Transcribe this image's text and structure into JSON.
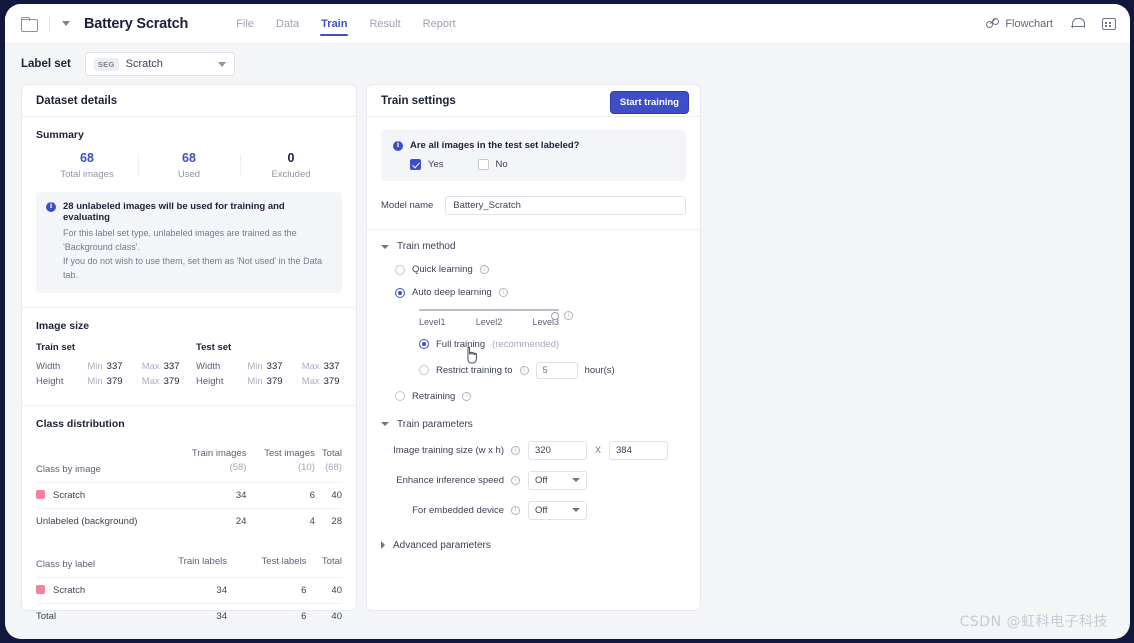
{
  "topbar": {
    "folder_icon": "folder-icon",
    "chevron_icon": "chevron-down-icon",
    "app_title": "Battery Scratch",
    "nav": [
      {
        "label": "File",
        "active": false
      },
      {
        "label": "Data",
        "active": false
      },
      {
        "label": "Train",
        "active": true
      },
      {
        "label": "Result",
        "active": false
      },
      {
        "label": "Report",
        "active": false
      }
    ],
    "flowchart_label": "Flowchart",
    "bell_icon": "bell-icon",
    "grid_icon": "grid-icon"
  },
  "labelset": {
    "label": "Label set",
    "badge": "SEG",
    "value": "Scratch"
  },
  "left_panel": {
    "title": "Dataset details",
    "summary": {
      "title": "Summary",
      "stats": [
        {
          "value": "68",
          "label": "Total images"
        },
        {
          "value": "68",
          "label": "Used"
        },
        {
          "value": "0",
          "label": "Excluded"
        }
      ],
      "callout": {
        "title": "28 unlabeled images will be used for training and evaluating",
        "line1": "For this label set type, unlabeled images are trained as the 'Background class'.",
        "line2": "If you do not wish to use them, set them as 'Not used' in the Data tab."
      }
    },
    "image_size": {
      "title": "Image size",
      "sets": [
        {
          "name": "Train set",
          "rows": [
            {
              "dim": "Width",
              "min_label": "Min",
              "min": "337",
              "max_label": "Max",
              "max": "337"
            },
            {
              "dim": "Height",
              "min_label": "Min",
              "min": "379",
              "max_label": "Max",
              "max": "379"
            }
          ]
        },
        {
          "name": "Test set",
          "rows": [
            {
              "dim": "Width",
              "min_label": "Min",
              "min": "337",
              "max_label": "Max",
              "max": "337"
            },
            {
              "dim": "Height",
              "min_label": "Min",
              "min": "379",
              "max_label": "Max",
              "max": "379"
            }
          ]
        }
      ]
    },
    "class_distribution": {
      "title": "Class distribution",
      "by_image": {
        "header": "Class by image",
        "col_train": "Train images",
        "col_train_sub": "(58)",
        "col_test": "Test images",
        "col_test_sub": "(10)",
        "col_total": "Total",
        "col_total_sub": "(68)",
        "rows": [
          {
            "name": "Scratch",
            "color": "#f77fa0",
            "swatch": true,
            "train": "34",
            "test": "6",
            "total": "40"
          },
          {
            "name": "Unlabeled (background)",
            "swatch": false,
            "train": "24",
            "test": "4",
            "total": "28"
          }
        ]
      },
      "by_label": {
        "header": "Class by label",
        "col_train": "Train labels",
        "col_test": "Test labels",
        "col_total": "Total",
        "rows": [
          {
            "name": "Scratch",
            "color": "#f77fa0",
            "swatch": true,
            "train": "34",
            "test": "6",
            "total": "40"
          },
          {
            "name": "Total",
            "swatch": false,
            "train": "34",
            "test": "6",
            "total": "40"
          }
        ]
      }
    }
  },
  "right_panel": {
    "title": "Train settings",
    "start_button": "Start training",
    "question": {
      "text": "Are all images in the test set labeled?",
      "options": [
        {
          "label": "Yes",
          "checked": true
        },
        {
          "label": "No",
          "checked": false
        }
      ]
    },
    "model_name": {
      "label": "Model name",
      "value": "Battery_Scratch"
    },
    "train_method": {
      "title": "Train method",
      "expanded": true,
      "options": [
        {
          "label": "Quick learning",
          "selected": false,
          "info": true
        },
        {
          "label": "Auto deep learning",
          "selected": true,
          "info": true
        },
        {
          "label": "Retraining",
          "selected": false,
          "info": true
        }
      ],
      "slider": {
        "levels": [
          "Level1",
          "Level2",
          "Level3"
        ],
        "value": "Level3"
      },
      "sub_options": [
        {
          "label": "Full training",
          "note": "(recommended)",
          "selected": true
        },
        {
          "label": "Restrict training to",
          "selected": false,
          "input_placeholder": "5",
          "unit": "hour(s)"
        }
      ]
    },
    "train_parameters": {
      "title": "Train parameters",
      "expanded": true,
      "rows": [
        {
          "label": "Image training size (w x h)",
          "type": "size",
          "width": "320",
          "sep": "X",
          "height": "384"
        },
        {
          "label": "Enhance inference speed",
          "type": "select",
          "value": "Off"
        },
        {
          "label": "For embedded device",
          "type": "select",
          "value": "Off"
        }
      ]
    },
    "advanced": {
      "title": "Advanced parameters",
      "expanded": false
    }
  },
  "watermark": "CSDN @虹科电子科技"
}
